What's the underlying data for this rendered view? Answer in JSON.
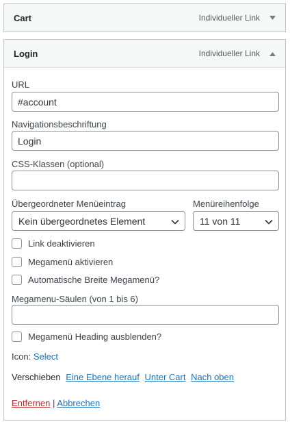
{
  "items": {
    "cart": {
      "title": "Cart",
      "type": "Individueller Link",
      "toggle_icon": "triangle-down-icon"
    },
    "login": {
      "title": "Login",
      "type": "Individueller Link",
      "toggle_icon": "triangle-up-icon"
    }
  },
  "form": {
    "url": {
      "label": "URL",
      "value": "#account"
    },
    "nav_label": {
      "label": "Navigationsbeschriftung",
      "value": "Login"
    },
    "css_classes": {
      "label": "CSS-Klassen (optional)",
      "value": ""
    },
    "parent": {
      "label": "Übergeordneter Menüeintrag",
      "selected": "Kein übergeordnetes Element"
    },
    "order": {
      "label": "Menüreihenfolge",
      "selected": "11 von 11"
    },
    "checkboxes": [
      {
        "label": "Link deaktivieren",
        "checked": false
      },
      {
        "label": "Megamenü aktivieren",
        "checked": false
      },
      {
        "label": "Automatische Breite Megamenü?",
        "checked": false
      }
    ],
    "mega_columns": {
      "label": "Megamenu-Säulen (von 1 bis 6)",
      "value": ""
    },
    "heading_hide": {
      "label": "Megamenü Heading ausblenden?",
      "checked": false
    },
    "icon": {
      "label": "Icon:",
      "link": "Select"
    },
    "move": {
      "label": "Verschieben",
      "links": [
        "Eine Ebene herauf",
        "Unter Cart",
        "Nach oben"
      ]
    },
    "actions": {
      "remove": "Entfernen",
      "separator": "|",
      "cancel": "Abbrechen"
    }
  },
  "colors": {
    "link": "#2271b1",
    "danger": "#b32d2e",
    "border": "#c3c4c7"
  }
}
